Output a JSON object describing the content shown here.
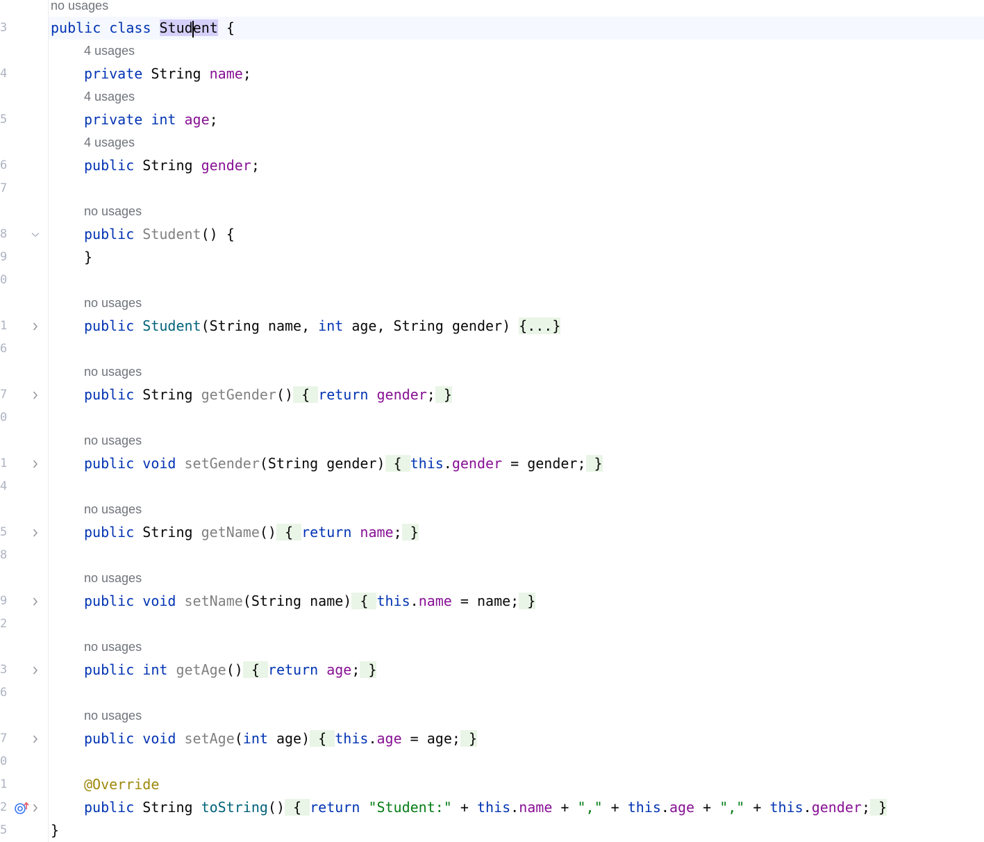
{
  "gutter": {
    "line_numbers": [
      "3",
      "4",
      "5",
      "6",
      "7",
      "8",
      "9",
      "0",
      "1",
      "6",
      "7",
      "0",
      "1",
      "4",
      "5",
      "8",
      "9",
      "2",
      "3",
      "6",
      "7",
      "0",
      "1",
      "2",
      "5"
    ]
  },
  "hints": {
    "no_usages": "no usages",
    "four_usages": "4 usages"
  },
  "code": {
    "l3_a": "public class ",
    "l3_cls_a": "Stud",
    "l3_cls_b": "ent",
    "l3_b": " {",
    "l4_kw": "private ",
    "l4_type": "String ",
    "l4_fld": "name",
    "l4_end": ";",
    "l5_kw": "private int ",
    "l5_fld": "age",
    "l5_end": ";",
    "l6_kw": "public ",
    "l6_type": "String ",
    "l6_fld": "gender",
    "l6_end": ";",
    "l8_kw": "public ",
    "l8_fn": "Student",
    "l8_end": "() {",
    "l9": "}",
    "l11_kw": "public ",
    "l11_fn": "Student",
    "l11_p1": "(String name, ",
    "l11_int": "int",
    "l11_p2": " age, String gender) ",
    "l11_fold": "{...}",
    "l17_kw": "public ",
    "l17_type": "String ",
    "l17_fn": "getGender",
    "l17_p": "()",
    "l17_ob": " { ",
    "l17_ret": "return ",
    "l17_fld": "gender",
    "l17_semi": ";",
    "l17_cb": " }",
    "l21_kw": "public void ",
    "l21_fn": "setGender",
    "l21_p": "(String gender)",
    "l21_ob": " { ",
    "l21_this": "this",
    "l21_dot": ".",
    "l21_fld": "gender",
    "l21_rest": " = gender;",
    "l21_cb": " }",
    "l25_kw": "public ",
    "l25_type": "String ",
    "l25_fn": "getName",
    "l25_p": "()",
    "l25_ob": " { ",
    "l25_ret": "return ",
    "l25_fld": "name",
    "l25_semi": ";",
    "l25_cb": " }",
    "l29_kw": "public void ",
    "l29_fn": "setName",
    "l29_p": "(String name)",
    "l29_ob": " { ",
    "l29_this": "this",
    "l29_dot": ".",
    "l29_fld": "name",
    "l29_rest": " = name;",
    "l29_cb": " }",
    "l33_kw": "public int ",
    "l33_fn": "getAge",
    "l33_p": "()",
    "l33_ob": " { ",
    "l33_ret": "return ",
    "l33_fld": "age",
    "l33_semi": ";",
    "l33_cb": " }",
    "l37_kw": "public void ",
    "l37_fn": "setAge",
    "l37_p1": "(",
    "l37_int": "int",
    "l37_p2": " age)",
    "l37_ob": " { ",
    "l37_this": "this",
    "l37_dot": ".",
    "l37_fld": "age",
    "l37_rest": " = age;",
    "l37_cb": " }",
    "l41_ann": "@Override",
    "l42_kw": "public ",
    "l42_type": "String ",
    "l42_fn": "toString",
    "l42_p": "()",
    "l42_ob": " { ",
    "l42_ret": "return ",
    "l42_s1": "\"Student:\"",
    "l42_plus1": " + ",
    "l42_this1": "this",
    "l42_d1": ".",
    "l42_f1": "name",
    "l42_plus2": " + ",
    "l42_s2": "\",\"",
    "l42_plus3": " + ",
    "l42_this2": "this",
    "l42_d2": ".",
    "l42_f2": "age",
    "l42_plus4": " + ",
    "l42_s3": "\",\"",
    "l42_plus5": " + ",
    "l42_this3": "this",
    "l42_d3": ".",
    "l42_f3": "gender",
    "l42_semi": ";",
    "l42_cb": " }",
    "l45": "}"
  },
  "colors": {
    "keyword": "#0033b3",
    "field": "#871094",
    "method": "#00627a",
    "unused": "#808080",
    "string": "#067d17",
    "annotation": "#9e880d",
    "fold_bg": "#e9f5e6",
    "selection": "#d5d0fa"
  },
  "icons": [
    "chevron-down-icon",
    "chevron-right-icon",
    "override-method-icon"
  ]
}
